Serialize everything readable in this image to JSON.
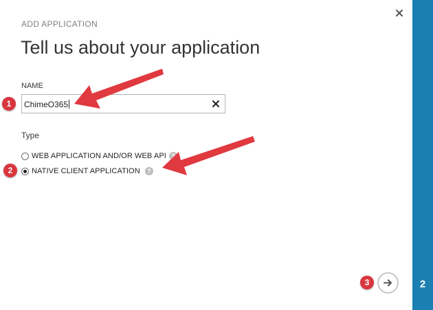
{
  "dialog": {
    "eyebrow": "ADD APPLICATION",
    "title": "Tell us about your application",
    "name": {
      "label": "NAME",
      "value": "ChimeO365"
    },
    "type": {
      "label": "Type",
      "options": [
        {
          "label": "WEB APPLICATION AND/OR WEB API",
          "selected": false
        },
        {
          "label": "NATIVE CLIENT APPLICATION",
          "selected": true
        }
      ]
    },
    "close_icon": "close-icon",
    "next_icon": "arrow-right-icon",
    "help_icon": "question-icon"
  },
  "wizard": {
    "step_number": "2",
    "accent_color": "#1b7fb1"
  },
  "annotations": {
    "badges": [
      "1",
      "2",
      "3"
    ],
    "color": "#d9363e"
  }
}
